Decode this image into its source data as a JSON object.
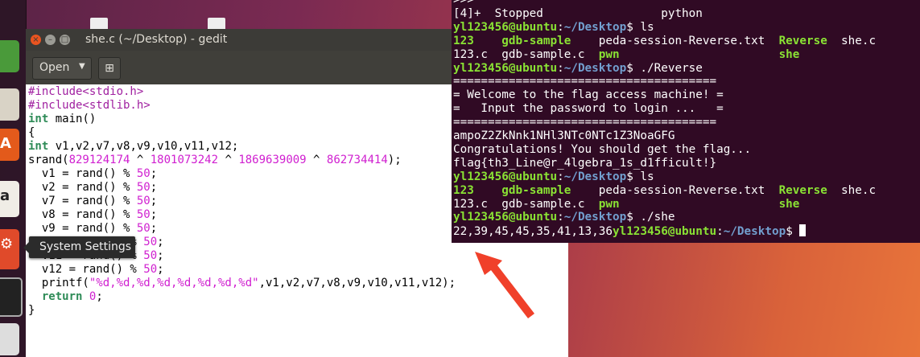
{
  "gedit": {
    "title": "she.c (~/Desktop) - gedit",
    "open_label": "Open",
    "new_tab_label": "⊞",
    "code": [
      {
        "parts": [
          {
            "c": "pp",
            "t": "#include<stdio.h>"
          }
        ]
      },
      {
        "parts": [
          {
            "c": "pp",
            "t": "#include<stdlib.h>"
          }
        ]
      },
      {
        "parts": [
          {
            "c": "kw",
            "t": "int"
          },
          {
            "c": "",
            "t": " main()"
          }
        ]
      },
      {
        "parts": [
          {
            "c": "",
            "t": "{"
          }
        ]
      },
      {
        "parts": [
          {
            "c": "kw",
            "t": "int"
          },
          {
            "c": "",
            "t": " v1,v2,v7,v8,v9,v10,v11,v12;"
          }
        ]
      },
      {
        "parts": [
          {
            "c": "",
            "t": "srand("
          },
          {
            "c": "num",
            "t": "829124174"
          },
          {
            "c": "",
            "t": " ^ "
          },
          {
            "c": "num",
            "t": "1801073242"
          },
          {
            "c": "",
            "t": " ^ "
          },
          {
            "c": "num",
            "t": "1869639009"
          },
          {
            "c": "",
            "t": " ^ "
          },
          {
            "c": "num",
            "t": "862734414"
          },
          {
            "c": "",
            "t": ");"
          }
        ]
      },
      {
        "parts": [
          {
            "c": "",
            "t": "  v1 = rand() % "
          },
          {
            "c": "num",
            "t": "50"
          },
          {
            "c": "",
            "t": ";"
          }
        ]
      },
      {
        "parts": [
          {
            "c": "",
            "t": "  v2 = rand() % "
          },
          {
            "c": "num",
            "t": "50"
          },
          {
            "c": "",
            "t": ";"
          }
        ]
      },
      {
        "parts": [
          {
            "c": "",
            "t": "  v7 = rand() % "
          },
          {
            "c": "num",
            "t": "50"
          },
          {
            "c": "",
            "t": ";"
          }
        ]
      },
      {
        "parts": [
          {
            "c": "",
            "t": "  v8 = rand() % "
          },
          {
            "c": "num",
            "t": "50"
          },
          {
            "c": "",
            "t": ";"
          }
        ]
      },
      {
        "parts": [
          {
            "c": "",
            "t": "  v9 = rand() % "
          },
          {
            "c": "num",
            "t": "50"
          },
          {
            "c": "",
            "t": ";"
          }
        ]
      },
      {
        "parts": [
          {
            "c": "",
            "t": "  v10 = rand() % "
          },
          {
            "c": "num",
            "t": "50"
          },
          {
            "c": "",
            "t": ";"
          }
        ]
      },
      {
        "parts": [
          {
            "c": "",
            "t": "  v11 = rand() % "
          },
          {
            "c": "num",
            "t": "50"
          },
          {
            "c": "",
            "t": ";"
          }
        ]
      },
      {
        "parts": [
          {
            "c": "",
            "t": "  v12 = rand() % "
          },
          {
            "c": "num",
            "t": "50"
          },
          {
            "c": "",
            "t": ";"
          }
        ]
      },
      {
        "parts": [
          {
            "c": "",
            "t": "  printf("
          },
          {
            "c": "str",
            "t": "\"%d,%d,%d,%d,%d,%d,%d,%d\""
          },
          {
            "c": "",
            "t": ",v1,v2,v7,v8,v9,v10,v11,v12);"
          }
        ]
      },
      {
        "parts": [
          {
            "c": "",
            "t": "  "
          },
          {
            "c": "kw",
            "t": "return"
          },
          {
            "c": "",
            "t": " "
          },
          {
            "c": "num",
            "t": "0"
          },
          {
            "c": "",
            "t": ";"
          }
        ]
      },
      {
        "parts": [
          {
            "c": "",
            "t": "}"
          }
        ]
      }
    ]
  },
  "tooltip": {
    "text": "System Settings"
  },
  "terminal": {
    "lines": [
      {
        "parts": [
          {
            "c": "",
            "t": ">>>"
          }
        ]
      },
      {
        "parts": [
          {
            "c": "",
            "t": "[4]+  Stopped                 python"
          }
        ]
      },
      {
        "parts": [
          {
            "c": "g",
            "t": "yl123456@ubuntu"
          },
          {
            "c": "",
            "t": ":"
          },
          {
            "c": "b",
            "t": "~/Desktop"
          },
          {
            "c": "",
            "t": "$ ls"
          }
        ]
      },
      {
        "parts": [
          {
            "c": "g",
            "t": "123"
          },
          {
            "c": "",
            "t": "    "
          },
          {
            "c": "g",
            "t": "gdb-sample"
          },
          {
            "c": "",
            "t": "    peda-session-Reverse.txt  "
          },
          {
            "c": "g",
            "t": "Reverse"
          },
          {
            "c": "",
            "t": "  she.c"
          }
        ]
      },
      {
        "parts": [
          {
            "c": "",
            "t": "123.c  gdb-sample.c  "
          },
          {
            "c": "g",
            "t": "pwn"
          },
          {
            "c": "",
            "t": "                       "
          },
          {
            "c": "g",
            "t": "she"
          }
        ]
      },
      {
        "parts": [
          {
            "c": "g",
            "t": "yl123456@ubuntu"
          },
          {
            "c": "",
            "t": ":"
          },
          {
            "c": "b",
            "t": "~/Desktop"
          },
          {
            "c": "",
            "t": "$ ./Reverse"
          }
        ]
      },
      {
        "parts": [
          {
            "c": "",
            "t": "======================================"
          }
        ]
      },
      {
        "parts": [
          {
            "c": "",
            "t": "= Welcome to the flag access machine! ="
          }
        ]
      },
      {
        "parts": [
          {
            "c": "",
            "t": "=   Input the password to login ...   ="
          }
        ]
      },
      {
        "parts": [
          {
            "c": "",
            "t": "======================================"
          }
        ]
      },
      {
        "parts": [
          {
            "c": "",
            "t": "ampoZ2ZkNnk1NHl3NTc0NTc1Z3NoaGFG"
          }
        ]
      },
      {
        "parts": [
          {
            "c": "",
            "t": "Congratulations! You should get the flag..."
          }
        ]
      },
      {
        "parts": [
          {
            "c": "",
            "t": "flag{th3_Line@r_4lgebra_1s_d1fficult!}"
          }
        ]
      },
      {
        "parts": [
          {
            "c": "g",
            "t": "yl123456@ubuntu"
          },
          {
            "c": "",
            "t": ":"
          },
          {
            "c": "b",
            "t": "~/Desktop"
          },
          {
            "c": "",
            "t": "$ ls"
          }
        ]
      },
      {
        "parts": [
          {
            "c": "g",
            "t": "123"
          },
          {
            "c": "",
            "t": "    "
          },
          {
            "c": "g",
            "t": "gdb-sample"
          },
          {
            "c": "",
            "t": "    peda-session-Reverse.txt  "
          },
          {
            "c": "g",
            "t": "Reverse"
          },
          {
            "c": "",
            "t": "  she.c"
          }
        ]
      },
      {
        "parts": [
          {
            "c": "",
            "t": "123.c  gdb-sample.c  "
          },
          {
            "c": "g",
            "t": "pwn"
          },
          {
            "c": "",
            "t": "                       "
          },
          {
            "c": "g",
            "t": "she"
          }
        ]
      },
      {
        "parts": [
          {
            "c": "g",
            "t": "yl123456@ubuntu"
          },
          {
            "c": "",
            "t": ":"
          },
          {
            "c": "b",
            "t": "~/Desktop"
          },
          {
            "c": "",
            "t": "$ ./she"
          }
        ]
      },
      {
        "parts": [
          {
            "c": "",
            "t": "22,39,45,45,35,41,13,36"
          },
          {
            "c": "g",
            "t": "yl123456@ubuntu"
          },
          {
            "c": "",
            "t": ":"
          },
          {
            "c": "b",
            "t": "~/Desktop"
          },
          {
            "c": "",
            "t": "$ "
          }
        ],
        "cursor": true
      }
    ]
  },
  "colors": {
    "terminal_bg": "#300a24",
    "prompt_user": "#8ae234",
    "prompt_path": "#729fcf",
    "arrow": "#f0402a"
  },
  "icons": [
    "files-icon",
    "spreadsheet-icon",
    "presentation-icon",
    "software-center-icon",
    "amazon-icon",
    "system-settings-icon",
    "terminal-icon",
    "text-editor-icon"
  ]
}
